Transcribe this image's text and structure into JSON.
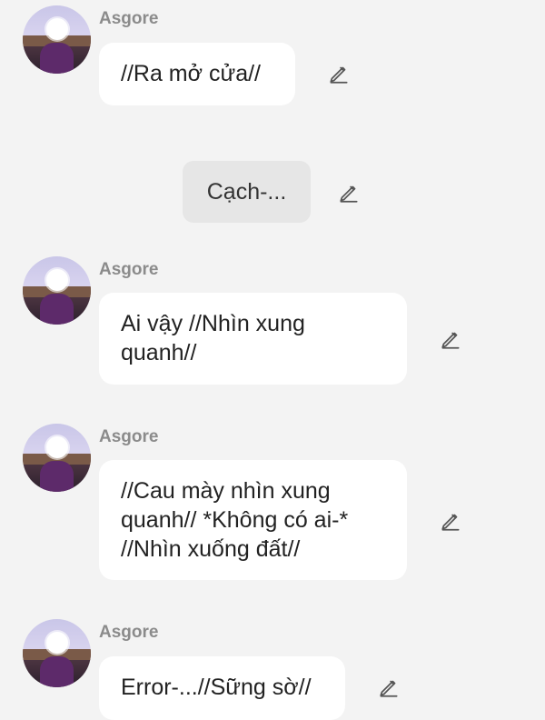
{
  "messages": [
    {
      "type": "character",
      "name": "Asgore",
      "text": "//Ra mở cửa//"
    },
    {
      "type": "user",
      "text": "Cạch-..."
    },
    {
      "type": "character",
      "name": "Asgore",
      "text": "Ai vậy //Nhìn xung quanh//"
    },
    {
      "type": "character",
      "name": "Asgore",
      "text": "//Cau mày nhìn xung quanh// *Không có ai-* //Nhìn xuống đất//"
    },
    {
      "type": "character",
      "name": "Asgore",
      "text": "Error-...//Sững sờ//"
    }
  ],
  "icons": {
    "avatar": "character-avatar",
    "edit": "pencil-icon"
  },
  "colors": {
    "background": "#f3f3f3",
    "bubble": "#ffffff",
    "user_bubble": "#e6e6e6",
    "name": "#8b8b8b"
  }
}
